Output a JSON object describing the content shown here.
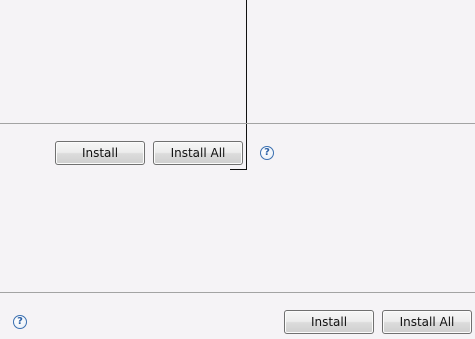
{
  "top_panel": {
    "install_label": "Install",
    "install_all_label": "Install All",
    "help_icon_glyph": "?"
  },
  "bottom_panel": {
    "install_label": "Install",
    "install_all_label": "Install All",
    "help_icon_glyph": "?"
  }
}
